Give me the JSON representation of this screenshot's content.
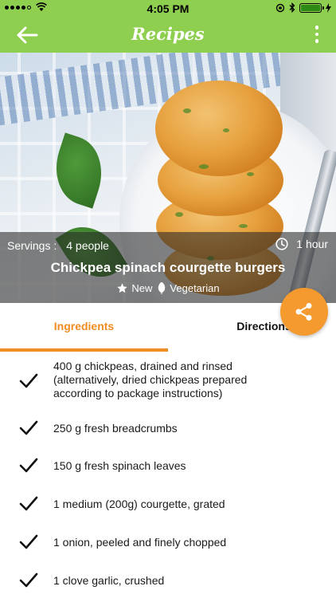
{
  "status_bar": {
    "time": "4:05 PM"
  },
  "nav": {
    "title": "Recipes",
    "back_icon": "arrow-left-icon",
    "menu_icon": "more-vertical-icon"
  },
  "recipe": {
    "servings_label": "Servings :",
    "servings_value": "4 people",
    "duration": "1 hour",
    "title": "Chickpea spinach courgette burgers",
    "tags": [
      "New",
      "Vegetarian"
    ]
  },
  "tabs": {
    "ingredients": "Ingredients",
    "directions": "Directions",
    "active": "ingredients"
  },
  "ingredients": [
    "400 g chickpeas, drained and rinsed (alternatively, dried chickpeas prepared according to package instructions)",
    "250 g fresh breadcrumbs",
    "150 g fresh spinach leaves",
    "1 medium (200g) courgette, grated",
    "1 onion, peeled and finely chopped",
    "1 clove garlic, crushed"
  ],
  "colors": {
    "header_green": "#8fcf4f",
    "accent_orange": "#f08d22",
    "fab_orange": "#f59a2e"
  }
}
